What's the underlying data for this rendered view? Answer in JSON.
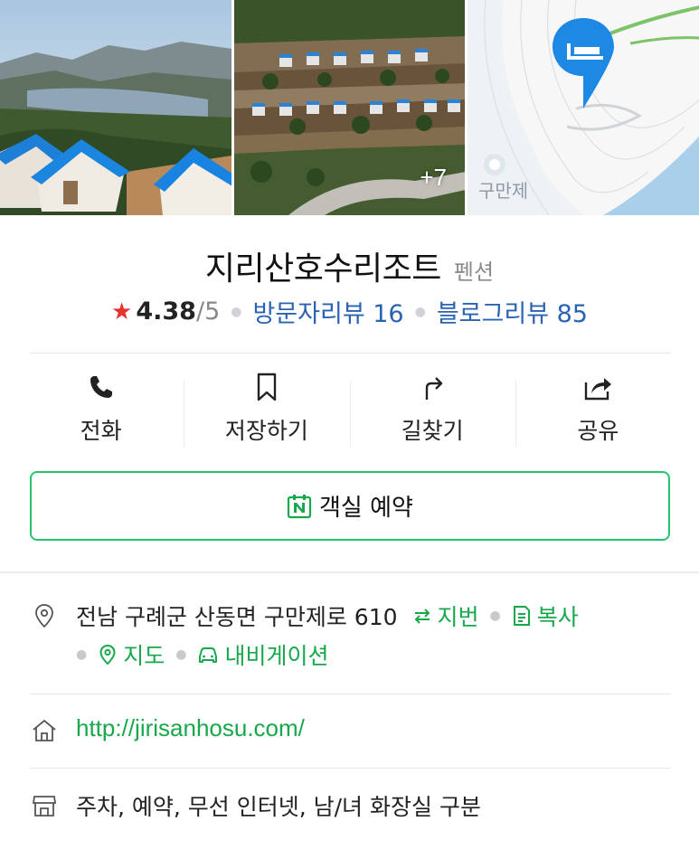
{
  "photos": {
    "more_count": "+7",
    "map_place_label": "구만제"
  },
  "place": {
    "name": "지리산호수리조트",
    "category": "펜션",
    "rating": {
      "score": "4.38",
      "out_of": "/5",
      "visitor_reviews": "방문자리뷰 16",
      "blog_reviews": "블로그리뷰 85"
    }
  },
  "actions": [
    {
      "label": "전화",
      "icon": "phone-icon"
    },
    {
      "label": "저장하기",
      "icon": "bookmark-icon"
    },
    {
      "label": "길찾기",
      "icon": "directions-icon"
    },
    {
      "label": "공유",
      "icon": "share-icon"
    }
  ],
  "reserve": {
    "label": "객실 예약",
    "icon": "naver-n-icon"
  },
  "address": {
    "text": "전남 구례군 산동면 구만제로 610",
    "jibun": "지번",
    "copy": "복사",
    "map": "지도",
    "navigation": "내비게이션"
  },
  "website": {
    "url": "http://jirisanhosu.com/"
  },
  "amenities": {
    "text": "주차, 예약, 무선 인터넷, 남/녀 화장실 구분"
  },
  "colors": {
    "accent_green": "#17a84b",
    "link_blue": "#2a63b4",
    "star_red": "#e8322f",
    "map_pin_blue": "#1e88e5"
  }
}
